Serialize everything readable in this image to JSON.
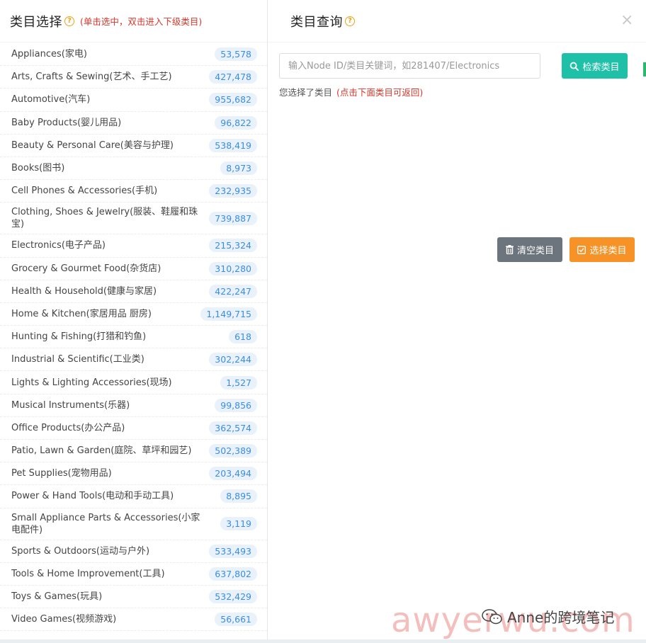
{
  "left": {
    "title": "类目选择",
    "hint": "(单击选中，双击进入下级类目)",
    "categories": [
      {
        "label": "Appliances(家电)",
        "count": "53,578"
      },
      {
        "label": "Arts, Crafts & Sewing(艺术、手工艺)",
        "count": "427,478"
      },
      {
        "label": "Automotive(汽车)",
        "count": "955,682"
      },
      {
        "label": "Baby Products(婴儿用品)",
        "count": "96,822"
      },
      {
        "label": "Beauty & Personal Care(美容与护理)",
        "count": "538,419"
      },
      {
        "label": "Books(图书)",
        "count": "8,973"
      },
      {
        "label": "Cell Phones & Accessories(手机)",
        "count": "232,935"
      },
      {
        "label": "Clothing, Shoes & Jewelry(服装、鞋履和珠宝)",
        "count": "739,887"
      },
      {
        "label": "Electronics(电子产品)",
        "count": "215,324"
      },
      {
        "label": "Grocery & Gourmet Food(杂货店)",
        "count": "310,280"
      },
      {
        "label": "Health & Household(健康与家居)",
        "count": "422,247"
      },
      {
        "label": "Home & Kitchen(家居用品 厨房)",
        "count": "1,149,715"
      },
      {
        "label": "Hunting & Fishing(打猎和钓鱼)",
        "count": "618"
      },
      {
        "label": "Industrial & Scientific(工业类)",
        "count": "302,244"
      },
      {
        "label": "Lights & Lighting Accessories(现场)",
        "count": "1,527"
      },
      {
        "label": "Musical Instruments(乐器)",
        "count": "99,856"
      },
      {
        "label": "Office Products(办公产品)",
        "count": "362,574"
      },
      {
        "label": "Patio, Lawn & Garden(庭院、草坪和园艺)",
        "count": "502,389"
      },
      {
        "label": "Pet Supplies(宠物用品)",
        "count": "203,494"
      },
      {
        "label": "Power & Hand Tools(电动和手动工具)",
        "count": "8,895"
      },
      {
        "label": "Small Appliance Parts & Accessories(小家电配件)",
        "count": "3,119"
      },
      {
        "label": "Sports & Outdoors(运动与户外)",
        "count": "533,493"
      },
      {
        "label": "Tools & Home Improvement(工具)",
        "count": "637,802"
      },
      {
        "label": "Toys & Games(玩具)",
        "count": "532,429"
      },
      {
        "label": "Video Games(视频游戏)",
        "count": "56,661"
      }
    ]
  },
  "right": {
    "title": "类目查询",
    "search_placeholder": "输入Node ID/类目关键词，如281407/Electronics",
    "search_button": "检索类目",
    "selected_text": "您选择了类目",
    "selected_hint": "(点击下面类目可返回)",
    "clear_button": "清空类目",
    "select_button": "选择类目"
  },
  "watermark": {
    "text": "awyerwu.com",
    "wechat_label": "Anne的跨境笔记"
  },
  "icons": {
    "help": "question-circle-icon",
    "close": "close-icon",
    "search": "search-icon",
    "trash": "trash-icon",
    "check": "check-square-icon",
    "wechat": "wechat-icon"
  },
  "colors": {
    "accent_green": "#1ec0a7",
    "orange": "#f79226",
    "gray_button": "#6c757d",
    "badge_text": "#3c8dde",
    "badge_bg": "#e9f2fb",
    "hint_red": "#d9362b"
  }
}
